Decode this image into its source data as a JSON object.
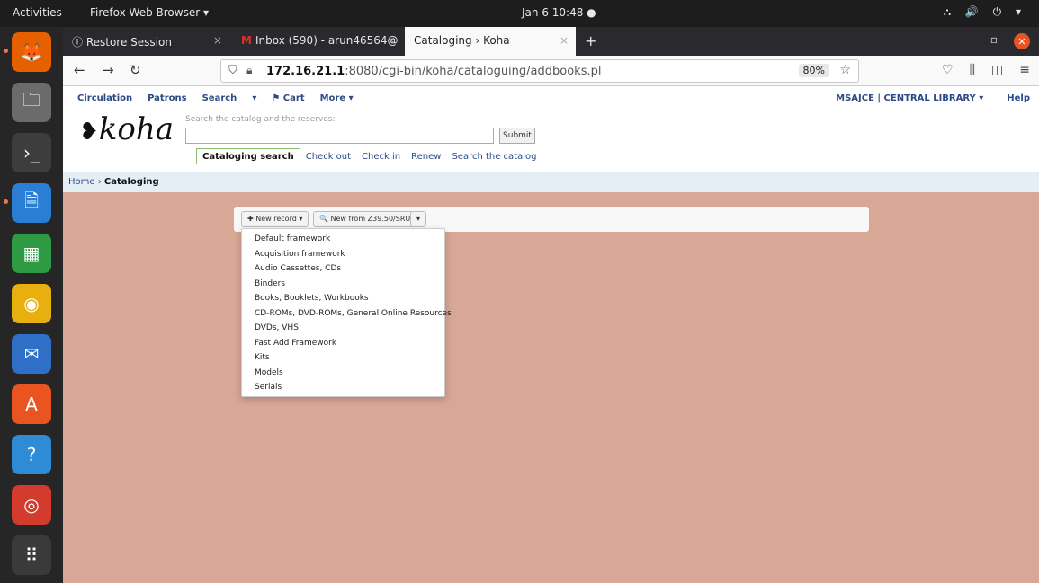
{
  "os": {
    "activities": "Activities",
    "app_menu": "Firefox Web Browser ▾",
    "clock": "Jan 6  10:48  ●",
    "tray": "⛬ 🔊 ⏻ ▾"
  },
  "dock": [
    {
      "name": "firefox-icon",
      "glyph": "🦊",
      "bg": "#e66000"
    },
    {
      "name": "files-icon",
      "glyph": "🗀",
      "bg": "#6b6b6b"
    },
    {
      "name": "terminal-icon",
      "glyph": "›_",
      "bg": "#3d3d3d"
    },
    {
      "name": "writer-icon",
      "glyph": "🗎",
      "bg": "#2a7fd4"
    },
    {
      "name": "calc-icon",
      "glyph": "▦",
      "bg": "#2e9b44"
    },
    {
      "name": "rhythmbox-icon",
      "glyph": "◉",
      "bg": "#e8b00f"
    },
    {
      "name": "thunderbird-icon",
      "glyph": "✉",
      "bg": "#2f6fc7"
    },
    {
      "name": "software-icon",
      "glyph": "A",
      "bg": "#e95420"
    },
    {
      "name": "help-icon",
      "glyph": "?",
      "bg": "#2e8bd6"
    },
    {
      "name": "chrome-icon",
      "glyph": "◎",
      "bg": "#d33b2f"
    },
    {
      "name": "app-grid-icon",
      "glyph": "⠿",
      "bg": "#3a3a3a"
    }
  ],
  "browser": {
    "tabs": [
      {
        "label": "ⓘ Restore Session",
        "close": "×"
      },
      {
        "label": "Inbox (590) - arun46564@",
        "gmail": "M",
        "close": "×"
      },
      {
        "label": "Cataloging › Koha",
        "close": "×"
      }
    ],
    "new_tab": "+",
    "url_host": "172.16.21.1",
    "url_rest": ":8080/cgi-bin/koha/cataloguing/addbooks.pl",
    "zoom": "80%"
  },
  "koha": {
    "nav": [
      "Circulation",
      "Patrons",
      "Search",
      "▾",
      "⚑ Cart",
      "More ▾"
    ],
    "library": "MSAJCE | CENTRAL LIBRARY ▾",
    "help": "Help",
    "logo": "koha",
    "search_hint": "Search the catalog and the reserves:",
    "submit": "Submit",
    "search_tabs": [
      "Cataloging search",
      "Check out",
      "Check in",
      "Renew",
      "Search the catalog"
    ],
    "breadcrumb_home": "Home",
    "breadcrumb_sep": " › ",
    "breadcrumb_current": "Cataloging",
    "new_record": "✚ New record ▾",
    "new_z3950": "🔍 New from Z39.50/SRU",
    "caret": "▾",
    "frameworks": [
      "Default framework",
      "Acquisition framework",
      "Audio Cassettes, CDs",
      "Binders",
      "Books, Booklets, Workbooks",
      "CD-ROMs, DVD-ROMs, General Online Resources",
      "DVDs, VHS",
      "Fast Add Framework",
      "Kits",
      "Models",
      "Serials"
    ]
  }
}
